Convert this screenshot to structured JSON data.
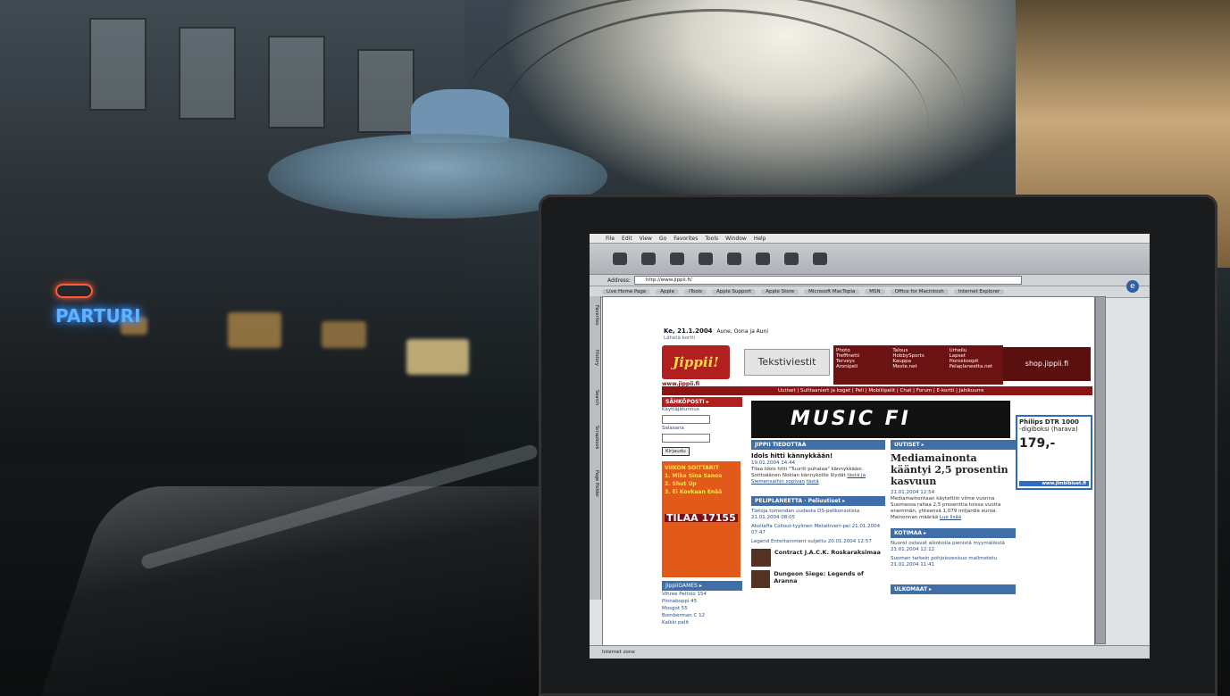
{
  "scene": {
    "neon_sign": "PARTURI",
    "accent_colors": {
      "neon_blue": "#5fb2ff",
      "jippii_red": "#b11f1f",
      "link_blue": "#2a4d80"
    }
  },
  "browser": {
    "menu": [
      "File",
      "Edit",
      "View",
      "Go",
      "Favorites",
      "Tools",
      "Window",
      "Help"
    ],
    "address_label": "Address:",
    "address_value": "http://www.jippii.fi/",
    "favorites": [
      "Live Home Page",
      "Apple",
      "iTools",
      "Apple Support",
      "Apple Store",
      "Microsoft MacTopia",
      "MSN",
      "Office for Macintosh",
      "Internet Explorer"
    ],
    "side_tabs": [
      "Favorites",
      "History",
      "Search",
      "Scrapbook",
      "Page Holder"
    ],
    "status": "Internet zone"
  },
  "page": {
    "date": "Ke, 21.1.2004",
    "date_names": "Aune, Oona ja Auni",
    "date_sub": "Lähetä kortti",
    "logo": "Jippii!",
    "logo_url": "www.jippii.fi",
    "teksti": "Tekstiviestit",
    "top_menu": [
      "Photo",
      "Treffinetti",
      "Terveys",
      "Aronipeli",
      "Talous",
      "HobbySports",
      "Kauppa",
      "Meste.net",
      "Urheilu",
      "Lapset",
      "Horoskoopit",
      "Pelaplaneetta.net"
    ],
    "shop": "shop.jippii.fi",
    "nav": "Uutiset | Sulttaaniert ja koget | Peli | Mobiilipelit | Chat | Forum | E-kortti | Jahikuurre",
    "login_head": "SÄHKÖPOSTI ▸",
    "login_user_label": "Käyttäjätunnus",
    "login_pass_label": "Salasana",
    "login_button": "Kirjaudu",
    "ad_lines": [
      "VIIKON SOITTARIT",
      "1. Mika Sina Sanoa",
      "2. Shut Up",
      "3. Ei Kovkaan Enää"
    ],
    "ad_big": "TILAA 17155",
    "games_head": "JippiiGAMES ▸",
    "games_list": [
      "Vihree Peltolo 154",
      "Pinnaboppi 45",
      "Mosgot 55",
      "Bomberman C 12",
      "Kaikki pelit"
    ],
    "music": "MUSIC FI",
    "philips_title": "Philips DTR 1000",
    "philips_sub": "-digiboksi (harava)",
    "philips_price": "179,-",
    "philips_link": "www.jimbibluet.fi",
    "jippii_head": "JIPPII TIEDOTTAA",
    "idols_title": "Idols hitti kännykkään!",
    "idols_date": "19.01.2004 14:44",
    "idols_text": "Tilaa Idols hitti \"Tuuriit puhalaa\" kännykkääsi. Soittoäänen Nokian kännykoille löydät",
    "idols_link": "tästä ja Siemensaihin sopivan",
    "idols_link2": "tästä",
    "peli_head": "PELIPLANEETTA · Peliuutiset ▸",
    "peli_items": [
      "Tietoja tomenden uudesta DS-pelikonsolista 21.01.2004 08:05",
      "Akollaffa Collout-tyylinen Metaltivert-pei 21.01.2004 07:47",
      "Legend Entertainment suljettu 20.01.2004 12:57"
    ],
    "game1": "Contract J.A.C.K. Roskaraksimaa",
    "game2": "Dungeon Siege: Legends of Aranna",
    "uutiset_head": "UUTISET ▸",
    "news_title": "Mediamainonta kääntyi 2,5 prosentin kasvuun",
    "news_date": "21.01.2004 12:54",
    "news_text": "Mediamainontaan käytettiin viime vuonna Suomessa rahaa 2,5 prosenttia toissa vuotta enemmän, yhteensä 1,079 miljardia euroa. Mainonnan määrää",
    "news_more": "Lue lisää",
    "kotimaa_head": "KOTIMAA ▸",
    "kotimaa_items": [
      "Nuoret ostavat alkoholia pienistä myymälöistä 21.01.2004 12:12",
      "Suomen tarkein pohjoisvesisuo mailmetetu 21.01.2004 11:41"
    ],
    "ulkomaat_head": "ULKOMAAT ▸"
  }
}
